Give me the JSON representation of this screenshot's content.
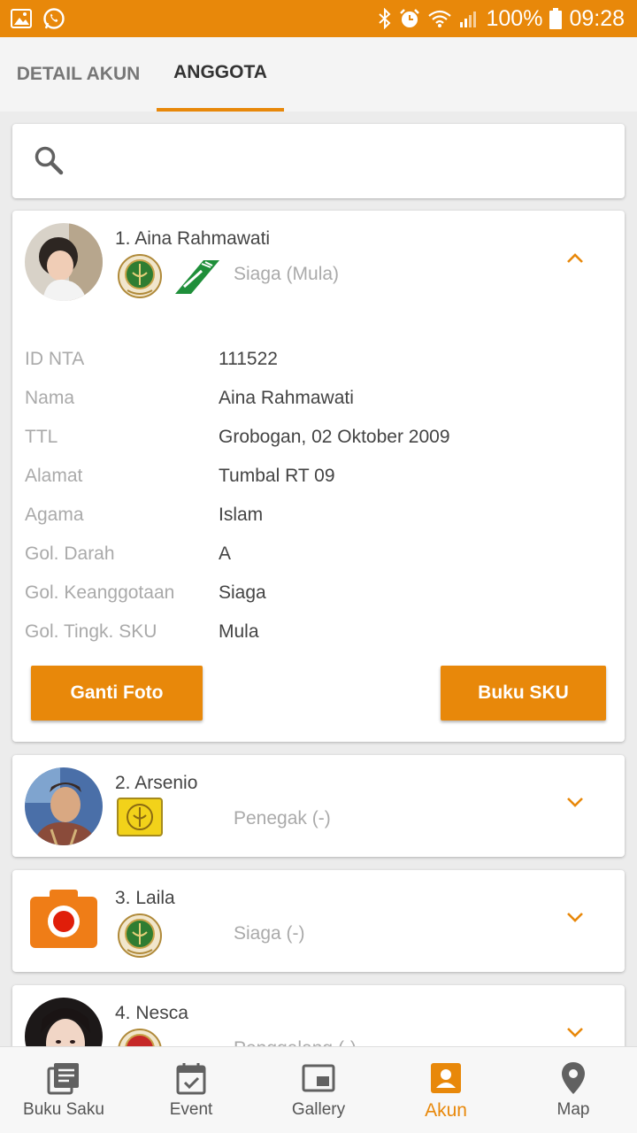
{
  "status": {
    "battery": "100%",
    "time": "09:28"
  },
  "tabs": [
    {
      "label": "DETAIL AKUN"
    },
    {
      "label": "ANGGOTA"
    }
  ],
  "members": [
    {
      "name": "1. Aina Rahmawati",
      "golongan": "Siaga (Mula)",
      "details": [
        {
          "label": "ID NTA",
          "value": "111522"
        },
        {
          "label": "Nama",
          "value": "Aina Rahmawati"
        },
        {
          "label": "TTL",
          "value": "Grobogan, 02 Oktober 2009"
        },
        {
          "label": "Alamat",
          "value": "Tumbal RT 09"
        },
        {
          "label": "Agama",
          "value": "Islam"
        },
        {
          "label": "Gol. Darah",
          "value": "A"
        },
        {
          "label": "Gol. Keanggotaan",
          "value": "Siaga"
        },
        {
          "label": "Gol. Tingk. SKU",
          "value": "Mula"
        }
      ],
      "buttons": {
        "change_photo": "Ganti Foto",
        "sku_book": "Buku SKU"
      }
    },
    {
      "name": "2. Arsenio",
      "golongan": "Penegak (-)"
    },
    {
      "name": "3. Laila",
      "golongan": "Siaga (-)"
    },
    {
      "name": "4. Nesca",
      "golongan": "Penggalang (-)"
    }
  ],
  "nav": [
    {
      "label": "Buku Saku",
      "icon": "book-icon"
    },
    {
      "label": "Event",
      "icon": "calendar-icon"
    },
    {
      "label": "Gallery",
      "icon": "gallery-icon"
    },
    {
      "label": "Akun",
      "icon": "account-icon"
    },
    {
      "label": "Map",
      "icon": "map-pin-icon"
    }
  ],
  "colors": {
    "accent": "#e8880a",
    "emblem_green": "#2f7d32",
    "penegak_yellow": "#f2d21a"
  }
}
